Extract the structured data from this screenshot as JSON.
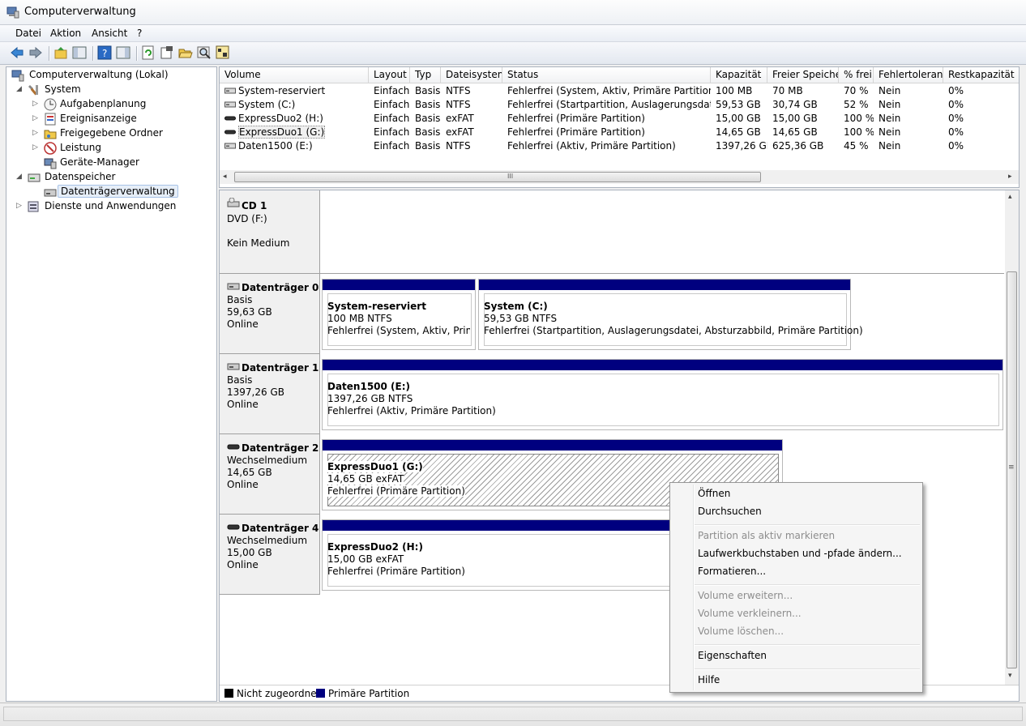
{
  "window": {
    "title": "Computerverwaltung"
  },
  "menu": [
    "Datei",
    "Aktion",
    "Ansicht",
    "?"
  ],
  "toolbar": [
    "back-icon",
    "forward-icon",
    "up-folder-icon",
    "show-hide-tree-icon",
    "help-icon",
    "show-hide-action-pane-icon",
    "refresh-icon",
    "properties-icon",
    "open-folder-icon",
    "search-icon",
    "disk-settings-icon"
  ],
  "tree": [
    {
      "label": "Computerverwaltung (Lokal)",
      "icon": "computer-management-icon",
      "expander": ""
    },
    {
      "label": "System",
      "icon": "tools-icon",
      "expander": "◢"
    },
    {
      "label": "Aufgabenplanung",
      "icon": "clock-icon",
      "expander": "▷"
    },
    {
      "label": "Ereignisanzeige",
      "icon": "event-viewer-icon",
      "expander": "▷"
    },
    {
      "label": "Freigegebene Ordner",
      "icon": "shared-folder-icon",
      "expander": "▷"
    },
    {
      "label": "Leistung",
      "icon": "performance-icon",
      "expander": "▷"
    },
    {
      "label": "Geräte-Manager",
      "icon": "device-manager-icon",
      "expander": ""
    },
    {
      "label": "Datenspeicher",
      "icon": "storage-icon",
      "expander": "◢"
    },
    {
      "label": "Datenträgerverwaltung",
      "icon": "disk-management-icon",
      "expander": ""
    },
    {
      "label": "Dienste und Anwendungen",
      "icon": "services-icon",
      "expander": "▷"
    }
  ],
  "volume_table": {
    "columns": [
      "Volume",
      "Layout",
      "Typ",
      "Dateisystem",
      "Status",
      "Kapazität",
      "Freier Speicher",
      "% frei",
      "Fehlertoleranz",
      "Restkapazität"
    ],
    "rows": [
      [
        "System-reserviert",
        "Einfach",
        "Basis",
        "NTFS",
        "Fehlerfrei (System, Aktiv, Primäre Partition)",
        "100 MB",
        "70 MB",
        "70 %",
        "Nein",
        "0%"
      ],
      [
        "System (C:)",
        "Einfach",
        "Basis",
        "NTFS",
        "Fehlerfrei (Startpartition, Auslagerungsdatei,",
        "59,53 GB",
        "30,74 GB",
        "52 %",
        "Nein",
        "0%"
      ],
      [
        "ExpressDuo2 (H:)",
        "Einfach",
        "Basis",
        "exFAT",
        "Fehlerfrei (Primäre Partition)",
        "15,00 GB",
        "15,00 GB",
        "100 %",
        "Nein",
        "0%"
      ],
      [
        "ExpressDuo1 (G:)",
        "Einfach",
        "Basis",
        "exFAT",
        "Fehlerfrei (Primäre Partition)",
        "14,65 GB",
        "14,65 GB",
        "100 %",
        "Nein",
        "0%"
      ],
      [
        "Daten1500 (E:)",
        "Einfach",
        "Basis",
        "NTFS",
        "Fehlerfrei (Aktiv, Primäre Partition)",
        "1397,26 GB",
        "625,36 GB",
        "45 %",
        "Nein",
        "0%"
      ]
    ],
    "scroll_grip": "III"
  },
  "disks": [
    {
      "name": "CD 1",
      "lines": [
        "DVD (F:)",
        "",
        "Kein Medium"
      ],
      "partitions": []
    },
    {
      "name": "Datenträger 0",
      "lines": [
        "Basis",
        "59,63 GB",
        "Online"
      ],
      "partitions": [
        {
          "name": "System-reserviert",
          "size": "100 MB NTFS",
          "status": "Fehlerfrei (System, Aktiv, Primäre"
        },
        {
          "name": "System  (C:)",
          "size": "59,53 GB NTFS",
          "status": "Fehlerfrei (Startpartition, Auslagerungsdatei, Absturzabbild, Primäre Partition)"
        }
      ]
    },
    {
      "name": "Datenträger 1",
      "lines": [
        "Basis",
        "1397,26 GB",
        "Online"
      ],
      "partitions": [
        {
          "name": "Daten1500  (E:)",
          "size": "1397,26 GB NTFS",
          "status": "Fehlerfrei (Aktiv, Primäre Partition)"
        }
      ]
    },
    {
      "name": "Datenträger 2",
      "lines": [
        "Wechselmedium",
        "14,65 GB",
        "Online"
      ],
      "partitions": [
        {
          "name": "ExpressDuo1  (G:)",
          "size": "14,65 GB exFAT",
          "status": "Fehlerfrei (Primäre Partition)"
        }
      ]
    },
    {
      "name": "Datenträger 4",
      "lines": [
        "Wechselmedium",
        "15,00 GB",
        "Online"
      ],
      "partitions": [
        {
          "name": "ExpressDuo2  (H:)",
          "size": "15,00 GB exFAT",
          "status": "Fehlerfrei (Primäre Partition)"
        }
      ]
    }
  ],
  "legend": [
    {
      "label": "Nicht zugeordnet",
      "color": "#000000"
    },
    {
      "label": "Primäre Partition",
      "color": "#00007f"
    }
  ],
  "context_menu": [
    {
      "label": "Öffnen",
      "enabled": true
    },
    {
      "label": "Durchsuchen",
      "enabled": true
    },
    {
      "label": "Partition als aktiv markieren",
      "enabled": false
    },
    {
      "label": "Laufwerkbuchstaben und -pfade ändern...",
      "enabled": true
    },
    {
      "label": "Formatieren...",
      "enabled": true
    },
    {
      "label": "Volume erweitern...",
      "enabled": false
    },
    {
      "label": "Volume verkleinern...",
      "enabled": false
    },
    {
      "label": "Volume löschen...",
      "enabled": false
    },
    {
      "label": "Eigenschaften",
      "enabled": true
    },
    {
      "label": "Hilfe",
      "enabled": true
    }
  ],
  "colors": {
    "primary_partition": "#00007f",
    "unallocated": "#000000",
    "selection": "#e6eef8"
  }
}
